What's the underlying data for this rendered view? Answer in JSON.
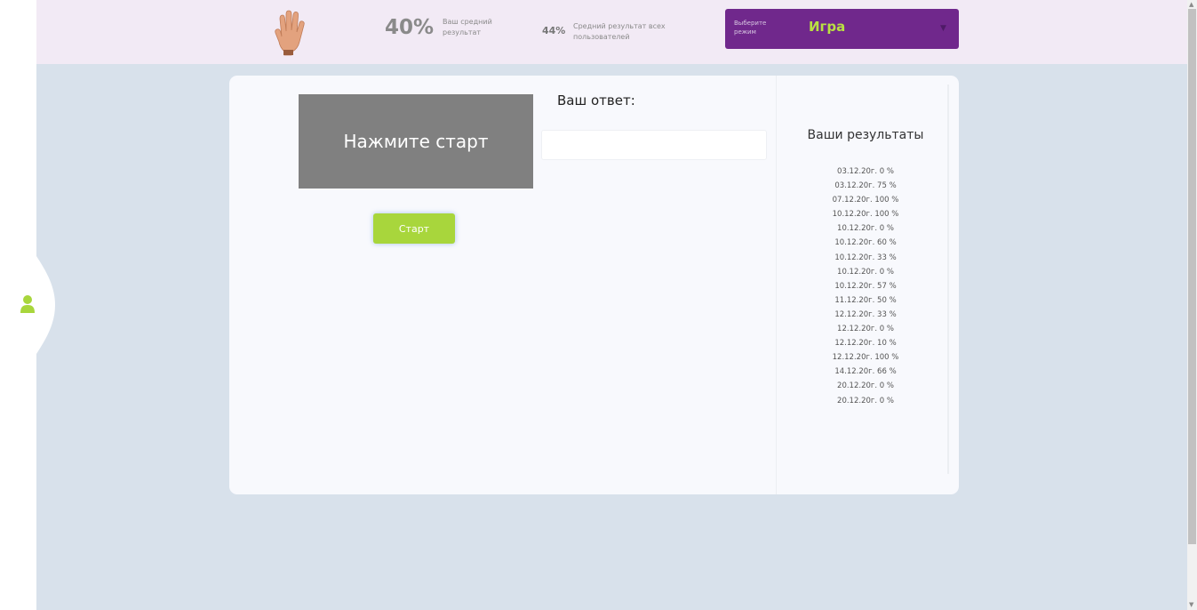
{
  "header": {
    "user_average_value": "40%",
    "user_average_label": "Ваш средний результат",
    "all_users_average_value": "44%",
    "all_users_average_label": "Средний результат всех пользователей",
    "mode_select": {
      "caption": "Выберите режим",
      "value": "Игра",
      "arrow_icon": "triangle-down-icon"
    },
    "hand_icon": "raised-hand-icon"
  },
  "sidebar": {
    "user_icon": "user-icon",
    "accent_color": "#a8d63c"
  },
  "game": {
    "display_text": "Нажмите старт",
    "start_button_label": "Старт",
    "answer_title": "Ваш ответ:",
    "answer_value": "",
    "answer_placeholder": ""
  },
  "results": {
    "title": "Ваши результаты",
    "items": [
      "03.12.20г. 0 %",
      "03.12.20г. 75 %",
      "07.12.20г. 100 %",
      "10.12.20г. 100 %",
      "10.12.20г. 0 %",
      "10.12.20г. 60 %",
      "10.12.20г. 33 %",
      "10.12.20г. 0 %",
      "10.12.20г. 57 %",
      "11.12.20г. 50 %",
      "12.12.20г. 33 %",
      "12.12.20г. 0 %",
      "12.12.20г. 10 %",
      "12.12.20г. 100 %",
      "14.12.20г. 66 %",
      "20.12.20г. 0 %",
      "20.12.20г. 0 %"
    ]
  },
  "colors": {
    "header_bg": "#f2eaf5",
    "main_bg": "#d8e1eb",
    "mode_bg": "#70288c",
    "mode_value": "#b9e142",
    "start_button": "#a8d63c",
    "display_bg": "#808080"
  }
}
